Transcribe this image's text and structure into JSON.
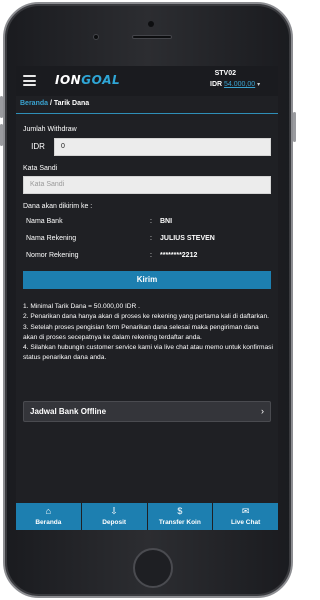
{
  "header": {
    "logo_prefix": "ION",
    "logo_suffix": "GOAL",
    "user_id": "STV02",
    "currency": "IDR",
    "balance": "54.000,00"
  },
  "breadcrumb": {
    "home": "Beranda",
    "separator": " / ",
    "current": "Tarik Dana"
  },
  "form": {
    "amount_label": "Jumlah Withdraw",
    "amount_prefix": "IDR",
    "amount_value": "0",
    "password_label": "Kata Sandi",
    "password_placeholder": "Kata Sandi",
    "destination_label": "Dana akan dikirim ke :",
    "bank_name_label": "Nama Bank",
    "bank_name_value": "BNI",
    "account_name_label": "Nama Rekening",
    "account_name_value": "JULIUS STEVEN",
    "account_number_label": "Nomor Rekening",
    "account_number_value": "********2212",
    "colon": ":",
    "submit_label": "Kirim"
  },
  "notes": [
    "1. Minimal Tarik Dana = 50.000,00 IDR .",
    "2. Penarikan dana hanya akan di proses ke rekening yang pertama kali di daftarkan.",
    "3. Setelah proses pengisian form Penarikan dana selesai maka pengiriman dana akan di proses secepatnya ke dalam rekening terdaftar anda.",
    "4. Silahkan hubungin customer service kami via live chat atau memo untuk konfirmasi status penarikan dana anda."
  ],
  "schedule": {
    "label": "Jadwal Bank Offline",
    "chevron": "›"
  },
  "bottom_nav": [
    {
      "label": "Beranda",
      "icon": "home-icon",
      "glyph": "⌂"
    },
    {
      "label": "Deposit",
      "icon": "deposit-icon",
      "glyph": "⇩"
    },
    {
      "label": "Transfer Koin",
      "icon": "coin-bag-icon",
      "glyph": "$"
    },
    {
      "label": "Live Chat",
      "icon": "chat-icon",
      "glyph": "✉"
    }
  ],
  "colors": {
    "accent": "#1d7fb0",
    "link": "#3aa3d0",
    "background": "#1f2024"
  }
}
